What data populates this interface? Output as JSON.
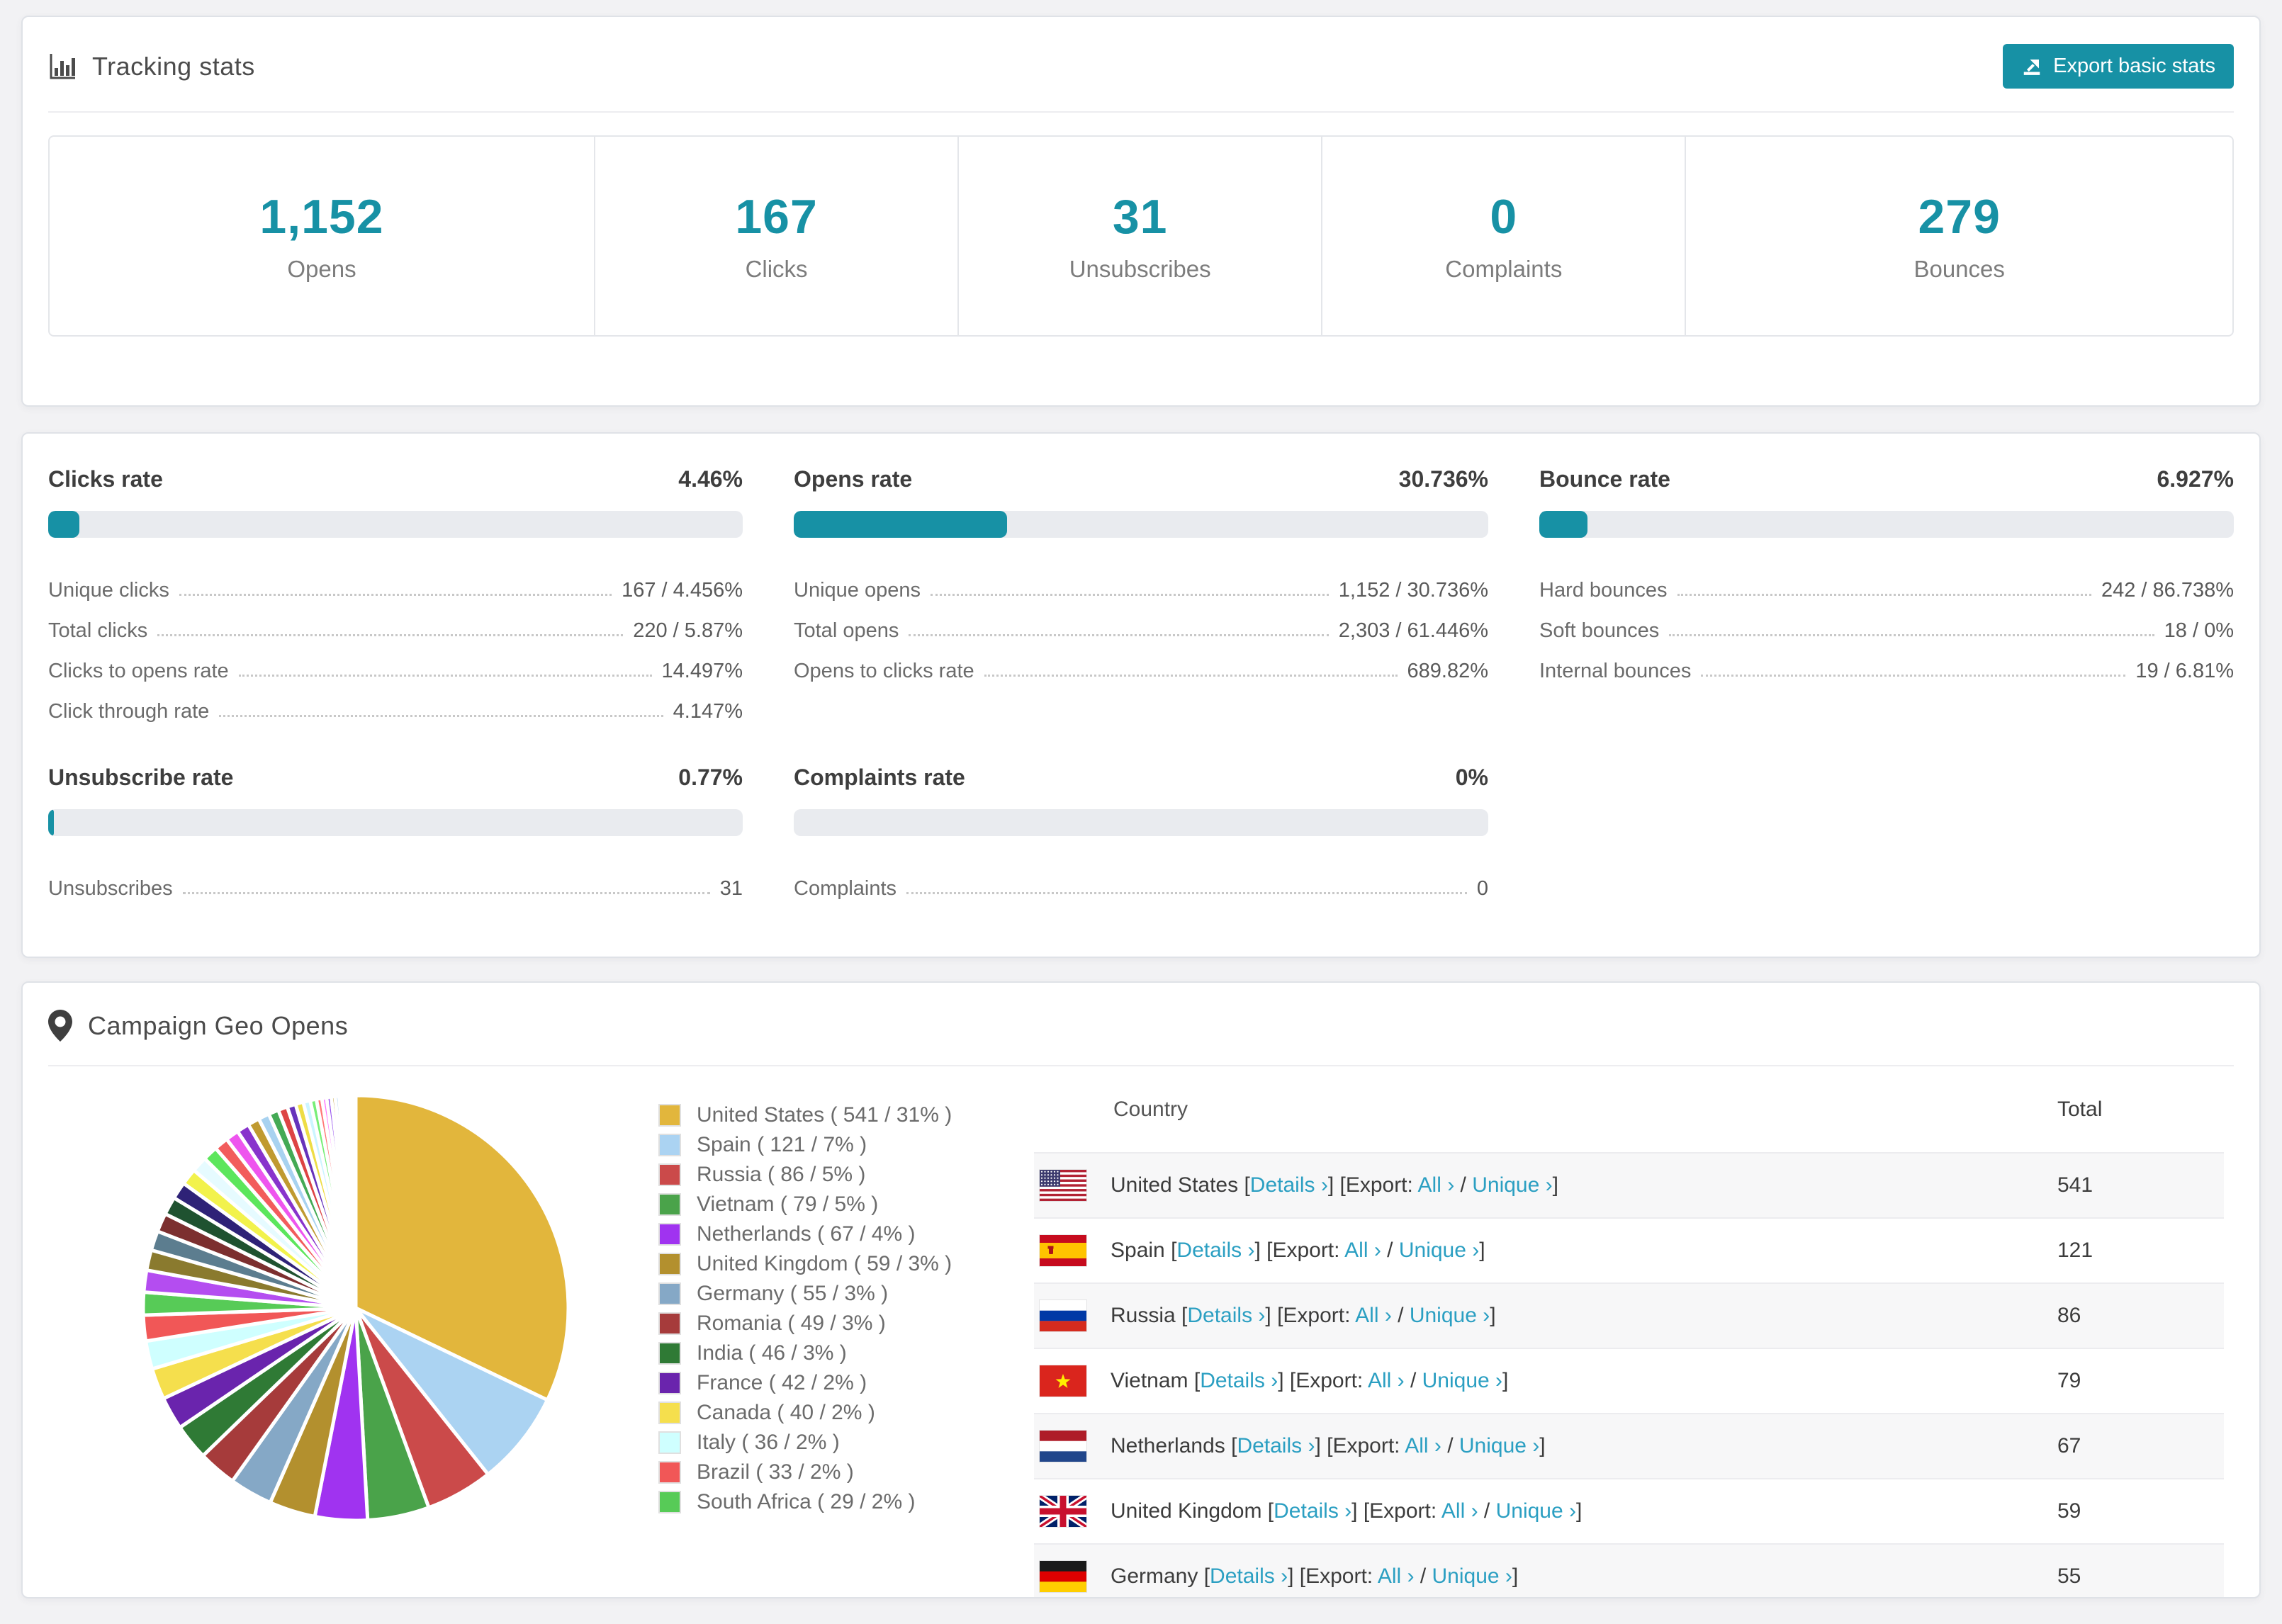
{
  "accent_color": "#1791a5",
  "link_color": "#2b9fc2",
  "tracking": {
    "title": "Tracking stats",
    "export_button": "Export basic stats",
    "stats": [
      {
        "value": "1,152",
        "label": "Opens"
      },
      {
        "value": "167",
        "label": "Clicks"
      },
      {
        "value": "31",
        "label": "Unsubscribes"
      },
      {
        "value": "0",
        "label": "Complaints"
      },
      {
        "value": "279",
        "label": "Bounces"
      }
    ]
  },
  "rates": [
    {
      "title": "Clicks rate",
      "value": "4.46%",
      "pct": 4.46,
      "rows": [
        {
          "label": "Unique clicks",
          "value": "167 / 4.456%"
        },
        {
          "label": "Total clicks",
          "value": "220 / 5.87%"
        },
        {
          "label": "Clicks to opens rate",
          "value": "14.497%"
        },
        {
          "label": "Click through rate",
          "value": "4.147%"
        }
      ]
    },
    {
      "title": "Opens rate",
      "value": "30.736%",
      "pct": 30.736,
      "rows": [
        {
          "label": "Unique opens",
          "value": "1,152 / 30.736%"
        },
        {
          "label": "Total opens",
          "value": "2,303 / 61.446%"
        },
        {
          "label": "Opens to clicks rate",
          "value": "689.82%"
        }
      ]
    },
    {
      "title": "Bounce rate",
      "value": "6.927%",
      "pct": 6.927,
      "rows": [
        {
          "label": "Hard bounces",
          "value": "242 / 86.738%"
        },
        {
          "label": "Soft bounces",
          "value": "18 / 0%"
        },
        {
          "label": "Internal bounces",
          "value": "19 / 6.81%"
        }
      ]
    },
    {
      "title": "Unsubscribe rate",
      "value": "0.77%",
      "pct": 0.77,
      "rows": [
        {
          "label": "Unsubscribes",
          "value": "31"
        }
      ]
    },
    {
      "title": "Complaints rate",
      "value": "0%",
      "pct": 0,
      "rows": [
        {
          "label": "Complaints",
          "value": "0"
        }
      ]
    }
  ],
  "geo": {
    "title": "Campaign Geo Opens",
    "table": {
      "headers": [
        "Country",
        "Total"
      ],
      "link_labels": {
        "details": "Details",
        "export": "Export:",
        "all": "All",
        "unique": "Unique"
      },
      "rows": [
        {
          "country": "United States",
          "flag": "us",
          "total": "541"
        },
        {
          "country": "Spain",
          "flag": "es",
          "total": "121"
        },
        {
          "country": "Russia",
          "flag": "ru",
          "total": "86"
        },
        {
          "country": "Vietnam",
          "flag": "vn",
          "total": "79"
        },
        {
          "country": "Netherlands",
          "flag": "nl",
          "total": "67"
        },
        {
          "country": "United Kingdom",
          "flag": "gb",
          "total": "59"
        },
        {
          "country": "Germany",
          "flag": "de",
          "total": "55"
        }
      ]
    }
  },
  "chart_data": {
    "type": "pie",
    "title": "Campaign Geo Opens",
    "legend_position": "right",
    "start_angle_deg": -90,
    "direction": "clockwise",
    "slices": [
      {
        "label": "United States",
        "value": 541,
        "pct": "31%",
        "color": "#e2b63c"
      },
      {
        "label": "Spain",
        "value": 121,
        "pct": "7%",
        "color": "#abd3f2"
      },
      {
        "label": "Russia",
        "value": 86,
        "pct": "5%",
        "color": "#cb4a4a"
      },
      {
        "label": "Vietnam",
        "value": 79,
        "pct": "5%",
        "color": "#4aa34a"
      },
      {
        "label": "Netherlands",
        "value": 67,
        "pct": "4%",
        "color": "#a033f0"
      },
      {
        "label": "United Kingdom",
        "value": 59,
        "pct": "3%",
        "color": "#b3902e"
      },
      {
        "label": "Germany",
        "value": 55,
        "pct": "3%",
        "color": "#85a8c6"
      },
      {
        "label": "Romania",
        "value": 49,
        "pct": "3%",
        "color": "#a63b3b"
      },
      {
        "label": "India",
        "value": 46,
        "pct": "3%",
        "color": "#2f7a35"
      },
      {
        "label": "France",
        "value": 42,
        "pct": "2%",
        "color": "#6a24ad"
      },
      {
        "label": "Canada",
        "value": 40,
        "pct": "2%",
        "color": "#f5df4d"
      },
      {
        "label": "Italy",
        "value": 36,
        "pct": "2%",
        "color": "#cfffff"
      },
      {
        "label": "Brazil",
        "value": 33,
        "pct": "2%",
        "color": "#f15757"
      },
      {
        "label": "South Africa",
        "value": 29,
        "pct": "2%",
        "color": "#57cb57"
      }
    ],
    "unlabeled_tail_slices": [
      [
        28,
        "#b44df0"
      ],
      [
        26,
        "#8a7a2e"
      ],
      [
        25,
        "#5c7d8f"
      ],
      [
        24,
        "#7c2f2f"
      ],
      [
        23,
        "#1f5230"
      ],
      [
        22,
        "#2e2277"
      ],
      [
        21,
        "#f2f24c"
      ],
      [
        20,
        "#e6fbff"
      ],
      [
        19,
        "#5ce65c"
      ],
      [
        18,
        "#f25c5c"
      ],
      [
        17,
        "#ee55ee"
      ],
      [
        16,
        "#8833cc"
      ],
      [
        15,
        "#c09a30"
      ],
      [
        14,
        "#a8d2f0"
      ],
      [
        13,
        "#44aa55"
      ],
      [
        12,
        "#dd4444"
      ],
      [
        11,
        "#6633bb"
      ],
      [
        10,
        "#eedd44"
      ],
      [
        9,
        "#ccf5ff"
      ],
      [
        8,
        "#77ee77"
      ],
      [
        7,
        "#ff7777"
      ],
      [
        6,
        "#ff77ff"
      ],
      [
        6,
        "#9955ee"
      ],
      [
        5,
        "#bb9933"
      ],
      [
        5,
        "#99ccee"
      ],
      [
        4,
        "#55bb66"
      ],
      [
        4,
        "#cc5555"
      ],
      [
        3,
        "#7744cc"
      ],
      [
        3,
        "#dddd55"
      ],
      [
        2,
        "#ddffff"
      ],
      [
        2,
        "#99ff99"
      ],
      [
        1,
        "#ff9999"
      ],
      [
        1,
        "#ff99ff"
      ],
      [
        1,
        "#bb88ff"
      ]
    ]
  }
}
